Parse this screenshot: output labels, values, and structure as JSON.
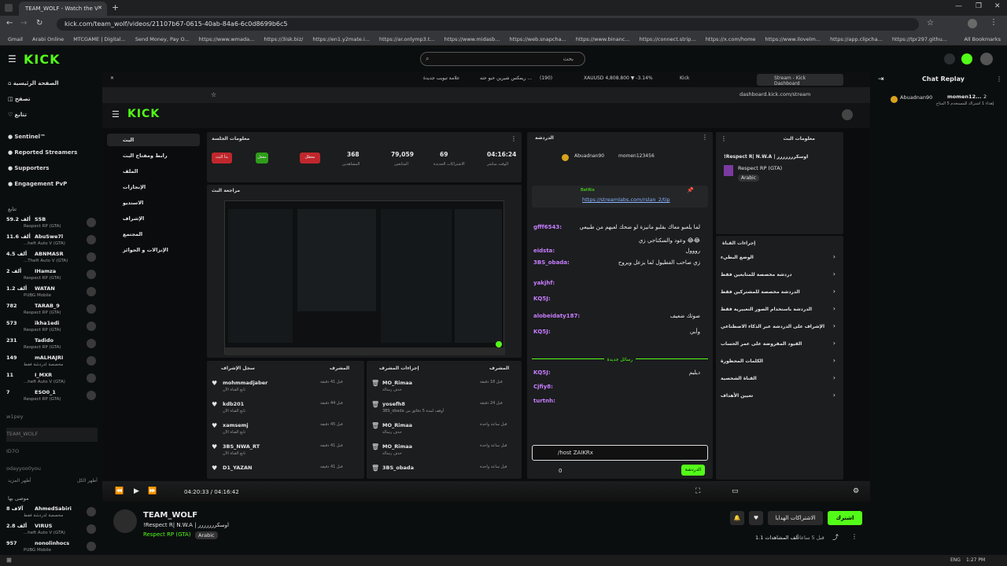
{
  "browser": {
    "tab_title": "TEAM_WOLF - Watch the V",
    "url": "kick.com/team_wolf/videos/21107b67-0615-40ab-84a6-6c0d8699b6c5",
    "bookmarks": [
      "Gmail",
      "Arabi Online",
      "MTCGAME | Digital...",
      "Send Money, Pay O...",
      "https://www.wmada...",
      "https://3isk.biz/",
      "https://en1.y2mate.i...",
      "https://ar.onlymp3.t...",
      "https://www.midasb...",
      "https://web.snapcha...",
      "https://www.binanc...",
      "https://connect.strip...",
      "https://x.com/home",
      "https://www.ilovelm...",
      "https://app.clipcha...",
      "https://tpr297.githu...",
      "All Bookmarks"
    ]
  },
  "kick": {
    "logo": "KICK",
    "search_placeholder": "بحث",
    "nav": [
      "الصفحة الرئيسية",
      "تصفح",
      "تتابع"
    ],
    "featured": [
      "Sentinel™",
      "Reported Streamers",
      "Supporters",
      "Engagement PvP"
    ],
    "following_label": "تتابع",
    "channels": [
      {
        "count": "59.2 ألف",
        "name": "S5B",
        "game": "Respect RP (GTA)"
      },
      {
        "count": "11.6 ألف",
        "name": "AbuSwe7l",
        "game": "...heft Auto V (GTA)"
      },
      {
        "count": "4.5 ألف",
        "name": "ABNMASR",
        "game": "...Theft Auto V (GTA)"
      },
      {
        "count": "2 ألف",
        "name": "IHamza",
        "game": "Respect RP (GTA)"
      },
      {
        "count": "1.2 ألف",
        "name": "WATAN",
        "game": "PUBG Mobile"
      },
      {
        "count": "782",
        "name": "TARAB_9",
        "game": "Respect RP (GTA)"
      },
      {
        "count": "573",
        "name": "ikha1edi",
        "game": "Respect RP (GTA)"
      },
      {
        "count": "231",
        "name": "Tadido",
        "game": "Respect RP (GTA)"
      },
      {
        "count": "149",
        "name": "mALHAJRI",
        "game": "مخصصة لدردشة فقط"
      },
      {
        "count": "11",
        "name": "I_MXR",
        "game": "...heft Auto V (GTA)"
      },
      {
        "count": "7",
        "name": "ESO0_1",
        "game": "Respect RP (GTA)"
      }
    ],
    "offline": [
      "w1pey",
      "TEAM_WOLF",
      "ID7O",
      "odayyoo0you"
    ],
    "show_more": "أظهر المزيد",
    "show_all": "أظهر الكل",
    "recommended_label": "موصى بها",
    "recommended": [
      {
        "count": "8 آلاف",
        "name": "AhmedSabiri",
        "game": "مخصصة لدردشة فقط"
      },
      {
        "count": "2.8 ألف",
        "name": "VIRUS",
        "game": "...heft Auto V (GTA)"
      },
      {
        "count": "957",
        "name": "nonolinhocs",
        "game": "PUBG Mobile"
      }
    ]
  },
  "inner": {
    "tabs": [
      "ريمكس شيرين حبو حته ...",
      "(190)",
      "XAUUSD 4,808.800 ▼ -3.14%",
      "Kick",
      "Stream - Kick Dashboard"
    ],
    "tab_left": "علامة تبويب جديدة",
    "url": "dashboard.kick.com/stream",
    "menu": [
      "البث",
      "رابط ومفتاح البث",
      "الملف",
      "الإنجازات",
      "الاستديو",
      "الإشراف",
      "المجتمع",
      "الإنزالات و الجوائز"
    ],
    "session_title": "معلومات الجلسة",
    "stats": [
      {
        "value": "04:16:24",
        "label": "الوقت مباشر"
      },
      {
        "value": "69",
        "label": "الاشتراكات الجديدة"
      },
      {
        "value": "79,059",
        "label": "المتابعين"
      },
      {
        "value": "368",
        "label": "المشاهدين"
      }
    ],
    "stat_buttons": [
      "معطل",
      "مفعل",
      "بدأ البث"
    ],
    "preview_title": "مراجعة البث",
    "chat_title": "الدردشة",
    "pinned_user": "Abuadnan90",
    "pinned_user2": "momen123456",
    "pinned_link": "https://streamlabs.com/rslan_2/tip",
    "pinned_by": "BetRix",
    "chat": [
      {
        "user": "gfff6543:",
        "text": "لما يلعبو معاك بقلبو مانيزة لو ضحك لعبهم من طبيعي"
      },
      {
        "user": "",
        "text": "وعود والسكناجي زي 😂😂"
      },
      {
        "user": "eidsta:",
        "text": "رووول"
      },
      {
        "user": "3BS_obada:",
        "text": "زي صاحب الفطيول لما يزعل ويروح"
      },
      {
        "user": "yakjhf:",
        "text": ""
      },
      {
        "user": "KQ5J:",
        "text": ""
      },
      {
        "user": "alobeidaty187:",
        "text": "صوتك ضعيف"
      },
      {
        "user": "KQ5J:",
        "text": "وأبي"
      },
      {
        "user": "KQ5J:",
        "text": "ديليم"
      },
      {
        "user": "Cjfiy8:",
        "text": ""
      },
      {
        "user": "turtnh:",
        "text": ""
      }
    ],
    "new_messages": "رسائل جديدة",
    "chat_input": "/host ZAIKRx",
    "chat_send": "الدردشة",
    "chat_points": "0",
    "stream_info_title": "معلومات البث",
    "stream_title": "!Respect R| N.W.A | اوسكررررررر",
    "category": "Respect RP (GTA)",
    "language": "Arabic",
    "actions_title": "إجراءات القناة",
    "actions": [
      "الوضع البطيء",
      "دردشة مخصصة للمتابعين فقط",
      "الدردشة مخصصة للمشتركين فقط",
      "الدردشة باستخدام الصور التعبيرية فقط",
      "الإشراف على الدردشة عبر الذكاء الاصطناعي",
      "القيود المفروضة على عمر الحساب",
      "الكلمات المحظورة",
      "القناة الشخصية",
      "تعيين الأهداف"
    ],
    "mod_log_title": "سجل الإشراف",
    "mod_col": "المشرف",
    "mod_actions_title": "إجراءات المشرف",
    "users": [
      {
        "name": "mohmmadjaber",
        "sub": "تابع القناة الآن",
        "time": "قبل 41 دقيقة"
      },
      {
        "name": "kdb201",
        "sub": "تابع القناة الآن",
        "time": "قبل 44 دقيقة"
      },
      {
        "name": "xamsemj",
        "sub": "تابع القناة الآن",
        "time": "قبل 45 دقيقة"
      },
      {
        "name": "3BS_NWA_RT",
        "sub": "تابع القناة الآن",
        "time": "قبل 41 دقيقة"
      },
      {
        "name": "D1_YAZAN",
        "sub": "",
        "time": "قبل 41 دقيقة"
      }
    ],
    "mods": [
      {
        "name": "MO_Rimaa",
        "sub": "حذف رسالة",
        "time": "قبل 18 دقيقة"
      },
      {
        "name": "yosefh8",
        "sub": "3BS_obada أوقف لمدة 5 دقائق من",
        "time": "قبل 24 دقيقة"
      },
      {
        "name": "MO_Rimaa",
        "sub": "حذف رسالة",
        "time": "قبل ساعة واحدة"
      },
      {
        "name": "MO_Rimaa",
        "sub": "حذف رسالة",
        "time": "قبل ساعة واحدة"
      },
      {
        "name": "3BS_obada",
        "sub": "",
        "time": "قبل ساعة واحدة"
      }
    ]
  },
  "player": {
    "time": "04:20:33 / 04:16:42",
    "progress_fraction": 1.0
  },
  "replay": {
    "title": "Chat Replay",
    "user1": "Abuadnan90",
    "user2": "momen12...",
    "count": "2",
    "note": "إهداء 1 اشتراك للمستخدم 5 المتاح"
  },
  "video_info": {
    "channel": "TEAM_WOLF",
    "title": "!Respect R| N.W.A | اوسكررررررر",
    "category": "Respect RP (GTA)",
    "language": "Arabic",
    "views": "1.1 ألف المشاهدات",
    "ago": "قبل 5 ساعات",
    "subscribe": "الاشتراكات الهدايا",
    "follow": "اشترك"
  },
  "taskbar": {
    "lang": "ENG",
    "time": "1:27 PM"
  },
  "colors": {
    "accent": "#53fc18",
    "bg": "#0b0e0f",
    "red": "#e0202a"
  }
}
